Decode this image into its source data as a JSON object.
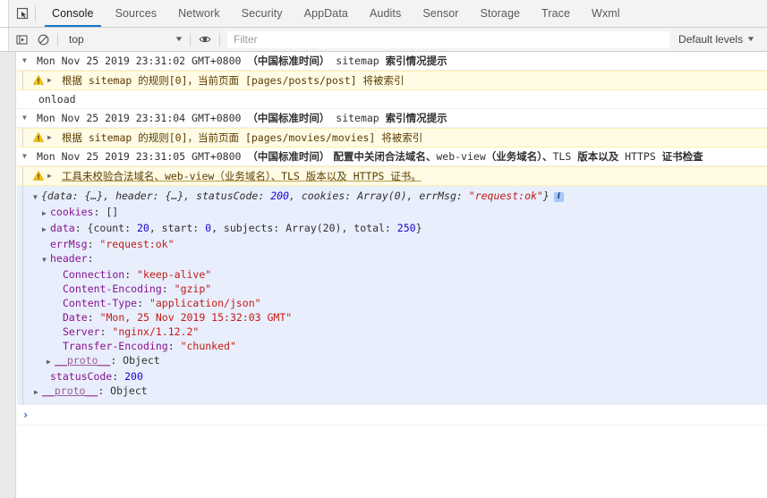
{
  "devtools": {
    "inspect_icon": "inspect-element-icon",
    "tabs": [
      {
        "label": "Console",
        "active": true
      },
      {
        "label": "Sources",
        "active": false
      },
      {
        "label": "Network",
        "active": false
      },
      {
        "label": "Security",
        "active": false
      },
      {
        "label": "AppData",
        "active": false
      },
      {
        "label": "Audits",
        "active": false
      },
      {
        "label": "Sensor",
        "active": false
      },
      {
        "label": "Storage",
        "active": false
      },
      {
        "label": "Trace",
        "active": false
      },
      {
        "label": "Wxml",
        "active": false
      }
    ]
  },
  "toolbar": {
    "sidebar_icon": "show-console-sidebar-icon",
    "clear_icon": "clear-console-icon",
    "context": "top",
    "context_caret": "▼",
    "eye_icon": "live-expression-eye-icon",
    "filter_value": "",
    "filter_placeholder": "Filter",
    "levels_label": "Default levels",
    "levels_caret": "▼"
  },
  "console": {
    "messages": [
      {
        "type": "group",
        "triangle": "▼",
        "segments": [
          {
            "text": "Mon Nov 25 2019 23:31:02 GMT+0800 ",
            "style": "mono"
          },
          {
            "text": "（中国标准时间）",
            "style": "cn-bold"
          },
          {
            "text": " sitemap ",
            "style": "mono"
          },
          {
            "text": "索引情况提示",
            "style": "cn-bold"
          }
        ]
      },
      {
        "type": "warn",
        "icon": "warning-triangle-icon",
        "triangle": "▶",
        "segments": [
          {
            "text": "根据",
            "style": "cn"
          },
          {
            "text": " sitemap ",
            "style": "mono"
          },
          {
            "text": "的规则",
            "style": "cn"
          },
          {
            "text": "[0]，",
            "style": "mono"
          },
          {
            "text": "当前页面",
            "style": "cn"
          },
          {
            "text": " [pages/posts/post] ",
            "style": "mono"
          },
          {
            "text": "将被索引",
            "style": "cn"
          }
        ]
      },
      {
        "type": "plain",
        "segments": [
          {
            "text": "onload",
            "style": "mono"
          }
        ]
      },
      {
        "type": "group",
        "triangle": "▼",
        "segments": [
          {
            "text": "Mon Nov 25 2019 23:31:04 GMT+0800 ",
            "style": "mono"
          },
          {
            "text": "（中国标准时间）",
            "style": "cn-bold"
          },
          {
            "text": " sitemap ",
            "style": "mono"
          },
          {
            "text": "索引情况提示",
            "style": "cn-bold"
          }
        ]
      },
      {
        "type": "warn",
        "icon": "warning-triangle-icon",
        "triangle": "▶",
        "segments": [
          {
            "text": "根据",
            "style": "cn"
          },
          {
            "text": " sitemap ",
            "style": "mono"
          },
          {
            "text": "的规则",
            "style": "cn"
          },
          {
            "text": "[0]，",
            "style": "mono"
          },
          {
            "text": "当前页面",
            "style": "cn"
          },
          {
            "text": " [pages/movies/movies] ",
            "style": "mono"
          },
          {
            "text": "将被索引",
            "style": "cn"
          }
        ]
      },
      {
        "type": "group",
        "triangle": "▼",
        "segments": [
          {
            "text": "Mon Nov 25 2019 23:31:05 GMT+0800 ",
            "style": "mono"
          },
          {
            "text": "（中国标准时间）",
            "style": "cn-bold"
          },
          {
            "text": " 配置中关闭合法域名、",
            "style": "cn-bold"
          },
          {
            "text": "web-view",
            "style": "mono"
          },
          {
            "text": "（业务域名）、",
            "style": "cn-bold"
          },
          {
            "text": "TLS ",
            "style": "mono"
          },
          {
            "text": "版本以及",
            "style": "cn-bold"
          },
          {
            "text": " HTTPS ",
            "style": "mono"
          },
          {
            "text": "证书检查",
            "style": "cn-bold"
          }
        ]
      },
      {
        "type": "warn",
        "icon": "warning-triangle-icon",
        "triangle": "▶",
        "underline": true,
        "segments": [
          {
            "text": "工具未校验合法域名、",
            "style": "cn"
          },
          {
            "text": "web-view",
            "style": "mono"
          },
          {
            "text": "（业务域名）、",
            "style": "cn"
          },
          {
            "text": "TLS ",
            "style": "mono"
          },
          {
            "text": "版本以及",
            "style": "cn"
          },
          {
            "text": " HTTPS ",
            "style": "mono"
          },
          {
            "text": "证书。",
            "style": "cn"
          }
        ]
      }
    ],
    "object_tree": {
      "summary": {
        "triangle": "▼",
        "tokens": [
          {
            "t": "{data: {…}, header: {…}, statusCode: ",
            "c": "v-obj"
          },
          {
            "t": "200",
            "c": "v-num"
          },
          {
            "t": ", cookies: Array(0), errMsg: ",
            "c": "v-obj"
          },
          {
            "t": "\"request:ok\"",
            "c": "v-str"
          },
          {
            "t": "}",
            "c": "v-obj"
          }
        ],
        "info_badge": "i"
      },
      "rows": [
        {
          "indent": 1,
          "triangle": "▶",
          "tokens": [
            {
              "t": "cookies",
              "c": "k-prop"
            },
            {
              "t": ": ",
              "c": "v-obj"
            },
            {
              "t": "[]",
              "c": "v-obj"
            }
          ]
        },
        {
          "indent": 1,
          "triangle": "▶",
          "tokens": [
            {
              "t": "data",
              "c": "k-prop"
            },
            {
              "t": ": {count: ",
              "c": "v-obj"
            },
            {
              "t": "20",
              "c": "v-num"
            },
            {
              "t": ", start: ",
              "c": "v-obj"
            },
            {
              "t": "0",
              "c": "v-num"
            },
            {
              "t": ", subjects: Array(20), total: ",
              "c": "v-obj"
            },
            {
              "t": "250",
              "c": "v-num"
            },
            {
              "t": "}",
              "c": "v-obj"
            }
          ]
        },
        {
          "indent": 1,
          "triangle": "",
          "tokens": [
            {
              "t": "errMsg",
              "c": "k-prop"
            },
            {
              "t": ": ",
              "c": "v-obj"
            },
            {
              "t": "\"request:ok\"",
              "c": "v-str"
            }
          ]
        },
        {
          "indent": 1,
          "triangle": "▼",
          "tokens": [
            {
              "t": "header",
              "c": "k-prop"
            },
            {
              "t": ":",
              "c": "v-obj"
            }
          ]
        },
        {
          "indent": 2,
          "triangle": "",
          "tokens": [
            {
              "t": "Connection",
              "c": "k-prop"
            },
            {
              "t": ": ",
              "c": "v-obj"
            },
            {
              "t": "\"keep-alive\"",
              "c": "v-str"
            }
          ]
        },
        {
          "indent": 2,
          "triangle": "",
          "tokens": [
            {
              "t": "Content-Encoding",
              "c": "k-prop"
            },
            {
              "t": ": ",
              "c": "v-obj"
            },
            {
              "t": "\"gzip\"",
              "c": "v-str"
            }
          ]
        },
        {
          "indent": 2,
          "triangle": "",
          "tokens": [
            {
              "t": "Content-Type",
              "c": "k-prop"
            },
            {
              "t": ": ",
              "c": "v-obj"
            },
            {
              "t": "\"application/json\"",
              "c": "v-str"
            }
          ]
        },
        {
          "indent": 2,
          "triangle": "",
          "tokens": [
            {
              "t": "Date",
              "c": "k-prop"
            },
            {
              "t": ": ",
              "c": "v-obj"
            },
            {
              "t": "\"Mon, 25 Nov 2019 15:32:03 GMT\"",
              "c": "v-str"
            }
          ]
        },
        {
          "indent": 2,
          "triangle": "",
          "tokens": [
            {
              "t": "Server",
              "c": "k-prop"
            },
            {
              "t": ": ",
              "c": "v-obj"
            },
            {
              "t": "\"nginx/1.12.2\"",
              "c": "v-str"
            }
          ]
        },
        {
          "indent": 2,
          "triangle": "",
          "tokens": [
            {
              "t": "Transfer-Encoding",
              "c": "k-prop"
            },
            {
              "t": ": ",
              "c": "v-obj"
            },
            {
              "t": "\"chunked\"",
              "c": "v-str"
            }
          ]
        },
        {
          "indent": 2,
          "triangle": "▶",
          "triangle_outdent": true,
          "tokens": [
            {
              "t": "__proto__",
              "c": "k-proto"
            },
            {
              "t": ": Object",
              "c": "v-obj"
            }
          ]
        },
        {
          "indent": 1,
          "triangle": "",
          "tokens": [
            {
              "t": "statusCode",
              "c": "k-prop"
            },
            {
              "t": ": ",
              "c": "v-obj"
            },
            {
              "t": "200",
              "c": "v-num"
            }
          ]
        },
        {
          "indent": 1,
          "triangle": "▶",
          "triangle_outdent": true,
          "tokens": [
            {
              "t": "__proto__",
              "c": "k-proto"
            },
            {
              "t": ": Object",
              "c": "v-obj"
            }
          ]
        }
      ]
    },
    "prompt": {
      "arrow": "›",
      "value": ""
    }
  }
}
